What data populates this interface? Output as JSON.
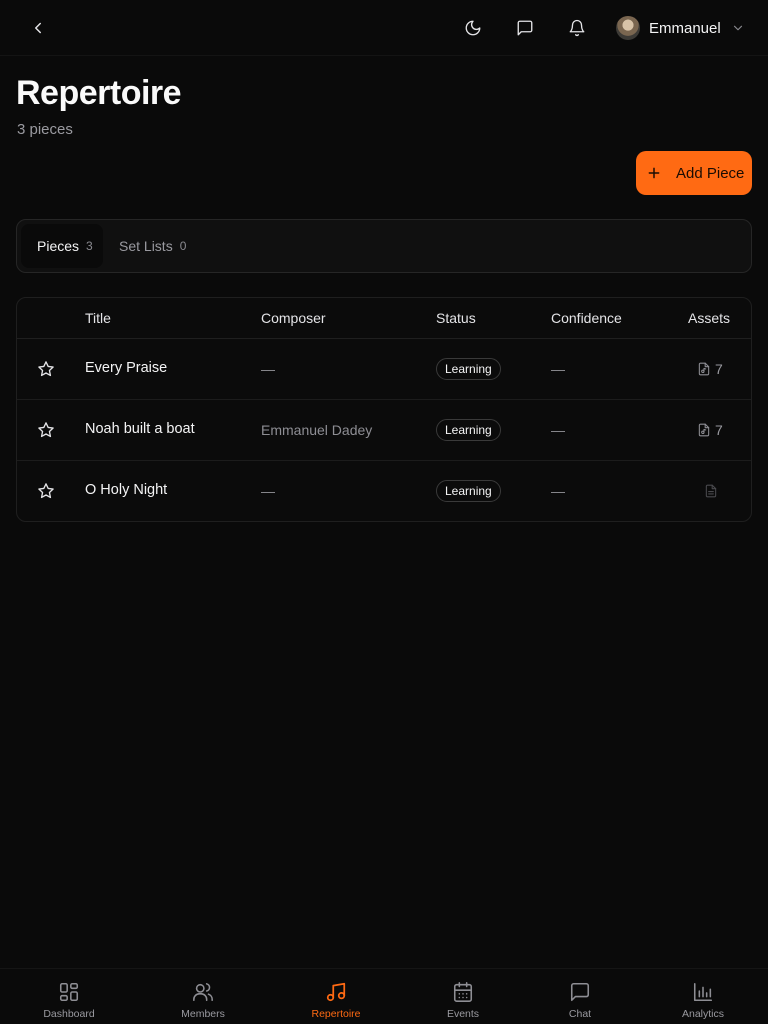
{
  "header": {
    "user_name": "Emmanuel"
  },
  "page": {
    "title": "Repertoire",
    "subtitle": "3 pieces",
    "add_button_label": "Add Piece"
  },
  "tabs": [
    {
      "label": "Pieces",
      "count": "3",
      "active": true
    },
    {
      "label": "Set Lists",
      "count": "0",
      "active": false
    }
  ],
  "table": {
    "columns": [
      "Title",
      "Composer",
      "Status",
      "Confidence",
      "Assets"
    ],
    "rows": [
      {
        "title": "Every Praise",
        "composer": "—",
        "status": "Learning",
        "confidence": "—",
        "assets": "7"
      },
      {
        "title": "Noah built a boat",
        "composer": "Emmanuel Dadey",
        "status": "Learning",
        "confidence": "—",
        "assets": "7"
      },
      {
        "title": "O Holy Night",
        "composer": "—",
        "status": "Learning",
        "confidence": "—",
        "assets": ""
      }
    ]
  },
  "bottom_nav": [
    {
      "label": "Dashboard",
      "icon": "grid-icon",
      "active": false
    },
    {
      "label": "Members",
      "icon": "users-icon",
      "active": false
    },
    {
      "label": "Repertoire",
      "icon": "music-note-icon",
      "active": true
    },
    {
      "label": "Events",
      "icon": "calendar-icon",
      "active": false
    },
    {
      "label": "Chat",
      "icon": "chat-bubble-icon",
      "active": false
    },
    {
      "label": "Analytics",
      "icon": "bar-chart-icon",
      "active": false
    }
  ],
  "colors": {
    "accent": "#ff6a13",
    "background": "#0a0a0a",
    "border": "#262626",
    "muted_text": "#9a9aa0"
  }
}
